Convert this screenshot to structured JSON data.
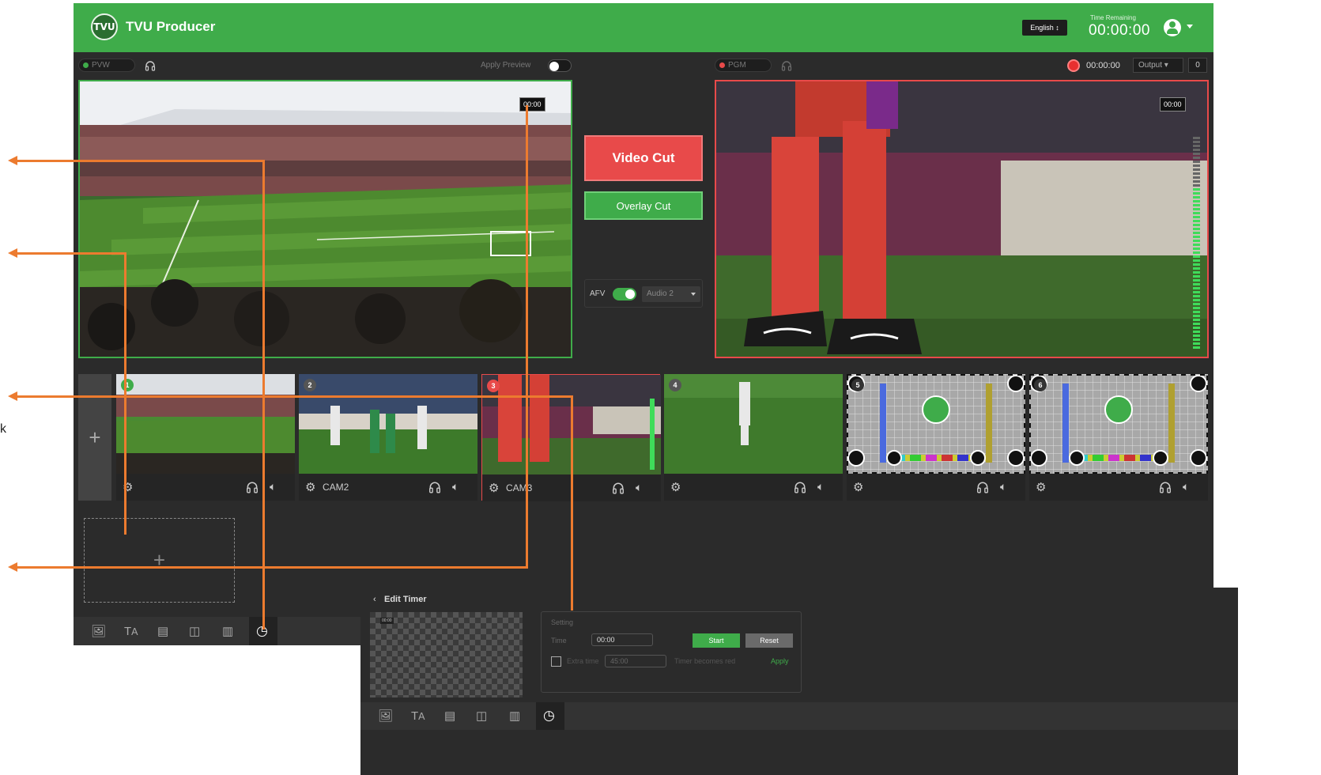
{
  "header": {
    "logo_text": "TVU",
    "title": "TVU Producer",
    "language": "English ↕",
    "time_remaining_label": "Time Remaining",
    "time_remaining_value": "00:00:00"
  },
  "preview": {
    "label": "PVW",
    "apply_preview_label": "Apply Preview",
    "timecode": "00:00"
  },
  "program": {
    "label": "PGM",
    "record_time": "00:00:00",
    "output_label": "Output ▾",
    "output_count": "0",
    "timecode": "00:00"
  },
  "controls": {
    "video_cut": "Video Cut",
    "overlay_cut": "Overlay Cut",
    "afv_label": "AFV",
    "audio_select": "Audio 2"
  },
  "sources": [
    {
      "number": "1",
      "name": ""
    },
    {
      "number": "2",
      "name": "CAM2"
    },
    {
      "number": "3",
      "name": "CAM3"
    },
    {
      "number": "4",
      "name": ""
    },
    {
      "number": "5",
      "name": ""
    },
    {
      "number": "6",
      "name": ""
    }
  ],
  "timer_panel": {
    "back_label": "Edit Timer",
    "setting_label": "Setting",
    "time_label": "Time",
    "time_value": "00:00",
    "start_label": "Start",
    "reset_label": "Reset",
    "extra_label": "Extra time",
    "extra_value": "45:00",
    "extra_hint": "Timer becomes red",
    "apply_label": "Apply",
    "thumb_text": "00:00"
  },
  "annotation_text": "k",
  "colors": {
    "brand_green": "#3fac4a",
    "cut_red": "#e84a4a",
    "annotation_orange": "#ec7b2f"
  }
}
